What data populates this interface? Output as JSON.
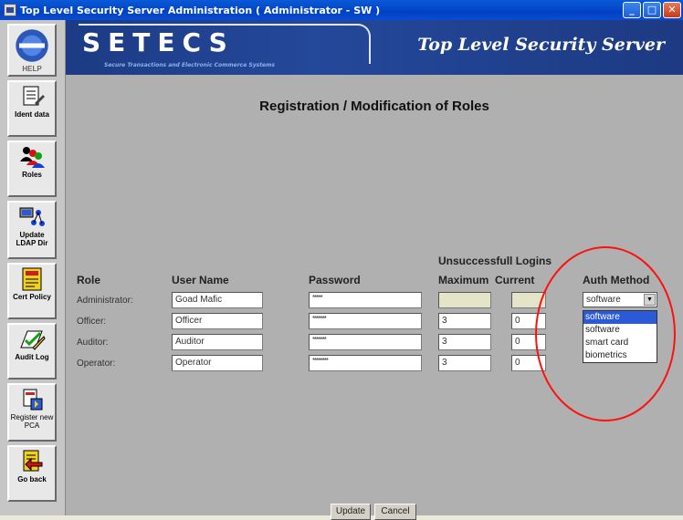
{
  "window": {
    "title": "Top Level Security Server Administration  ( Administrator - SW )",
    "controls": [
      "minimize",
      "maximize",
      "close"
    ]
  },
  "sidebar": {
    "items": [
      {
        "label": "HELP",
        "icon": "help-icon"
      },
      {
        "label": "Ident data",
        "icon": "ident-data-icon"
      },
      {
        "label": "Roles",
        "icon": "roles-icon"
      },
      {
        "label": "Update LDAP Dir",
        "icon": "ldap-directory-icon"
      },
      {
        "label": "Cert Policy",
        "icon": "certificate-icon"
      },
      {
        "label": "Audit Log",
        "icon": "audit-log-icon"
      },
      {
        "label": "Register new PCA",
        "icon": "register-pca-icon"
      },
      {
        "label": "Go back",
        "icon": "go-back-icon"
      }
    ]
  },
  "banner": {
    "logo": "SETECS",
    "tagline": "Secure Transactions and Electronic Commerce Systems",
    "product": "Top Level Security Server"
  },
  "page": {
    "title": "Registration / Modification of Roles"
  },
  "table": {
    "group_header": "Unsuccessfull Logins",
    "headers": {
      "role": "Role",
      "user_name": "User Name",
      "password": "Password",
      "maximum": "Maximum",
      "current": "Current",
      "auth_method": "Auth Method"
    },
    "rows": [
      {
        "role": "Administrator:",
        "user_name": "Goad Mafic",
        "password": "*****",
        "maximum": "",
        "current": "",
        "disabled": true
      },
      {
        "role": "Officer:",
        "user_name": "Officer",
        "password": "*******",
        "maximum": "3",
        "current": "0",
        "disabled": false
      },
      {
        "role": "Auditor:",
        "user_name": "Auditor",
        "password": "*******",
        "maximum": "3",
        "current": "0",
        "disabled": false
      },
      {
        "role": "Operator:",
        "user_name": "Operator",
        "password": "********",
        "maximum": "3",
        "current": "0",
        "disabled": false
      }
    ]
  },
  "auth_select": {
    "value": "software",
    "options": [
      "software",
      "software",
      "smart card",
      "biometrics"
    ],
    "highlighted_index": 0
  },
  "buttons": {
    "update": "Update",
    "cancel": "Cancel"
  },
  "colors": {
    "banner": "#1c3b84",
    "main_bg": "#b0b0b0",
    "annotation": "#ff1010",
    "selection": "#2a5ad8"
  }
}
